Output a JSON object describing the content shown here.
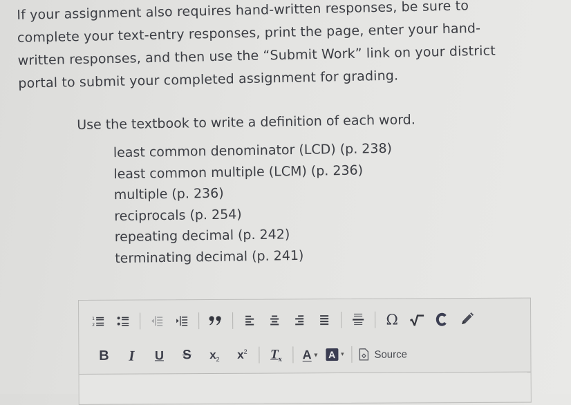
{
  "intro": {
    "lines": [
      "If your assignment also requires hand-written responses, be sure to",
      "complete your text-entry responses, print the page, enter your hand-",
      "written responses, and then use the “Submit Work” link on your district",
      "portal to submit your completed assignment for grading."
    ]
  },
  "instructions": {
    "lead": "Use the textbook to write a definition of each word.",
    "terms": [
      "least common denominator (LCD) (p. 238)",
      "least common multiple (LCM) (p. 236)",
      "multiple (p. 236)",
      "reciprocals (p. 254)",
      "repeating decimal (p. 242)",
      "terminating decimal (p. 241)"
    ]
  },
  "editor": {
    "toolbar_row1": [
      {
        "name": "numbered-list",
        "icon": "numbered-list-icon"
      },
      {
        "name": "bulleted-list",
        "icon": "bulleted-list-icon"
      },
      {
        "name": "decrease-indent",
        "icon": "outdent-icon",
        "disabled": true
      },
      {
        "name": "increase-indent",
        "icon": "indent-icon"
      },
      {
        "name": "blockquote",
        "icon": "quote-icon",
        "label": "”"
      },
      {
        "name": "align-left",
        "icon": "align-left-icon"
      },
      {
        "name": "align-center",
        "icon": "align-center-icon"
      },
      {
        "name": "align-right",
        "icon": "align-right-icon"
      },
      {
        "name": "align-justify",
        "icon": "align-justify-icon"
      },
      {
        "name": "horizontal-line",
        "icon": "horizontal-rule-icon"
      },
      {
        "name": "special-character",
        "icon": "omega-icon",
        "label": "Ω"
      },
      {
        "name": "math",
        "icon": "square-root-icon"
      },
      {
        "name": "chemistry",
        "icon": "c-icon",
        "label": "C"
      },
      {
        "name": "draw",
        "icon": "pencil-icon"
      }
    ],
    "toolbar_row2": {
      "bold": "B",
      "italic": "I",
      "underline": "U",
      "strike": "S",
      "subscript_base": "x",
      "subscript_mark": "2",
      "superscript_base": "x",
      "superscript_mark": "2",
      "remove_format_base": "T",
      "remove_format_mark": "x",
      "text_color": "A",
      "bg_color": "A",
      "dropdown_caret": "▾",
      "source_label": "Source"
    },
    "content": ""
  }
}
